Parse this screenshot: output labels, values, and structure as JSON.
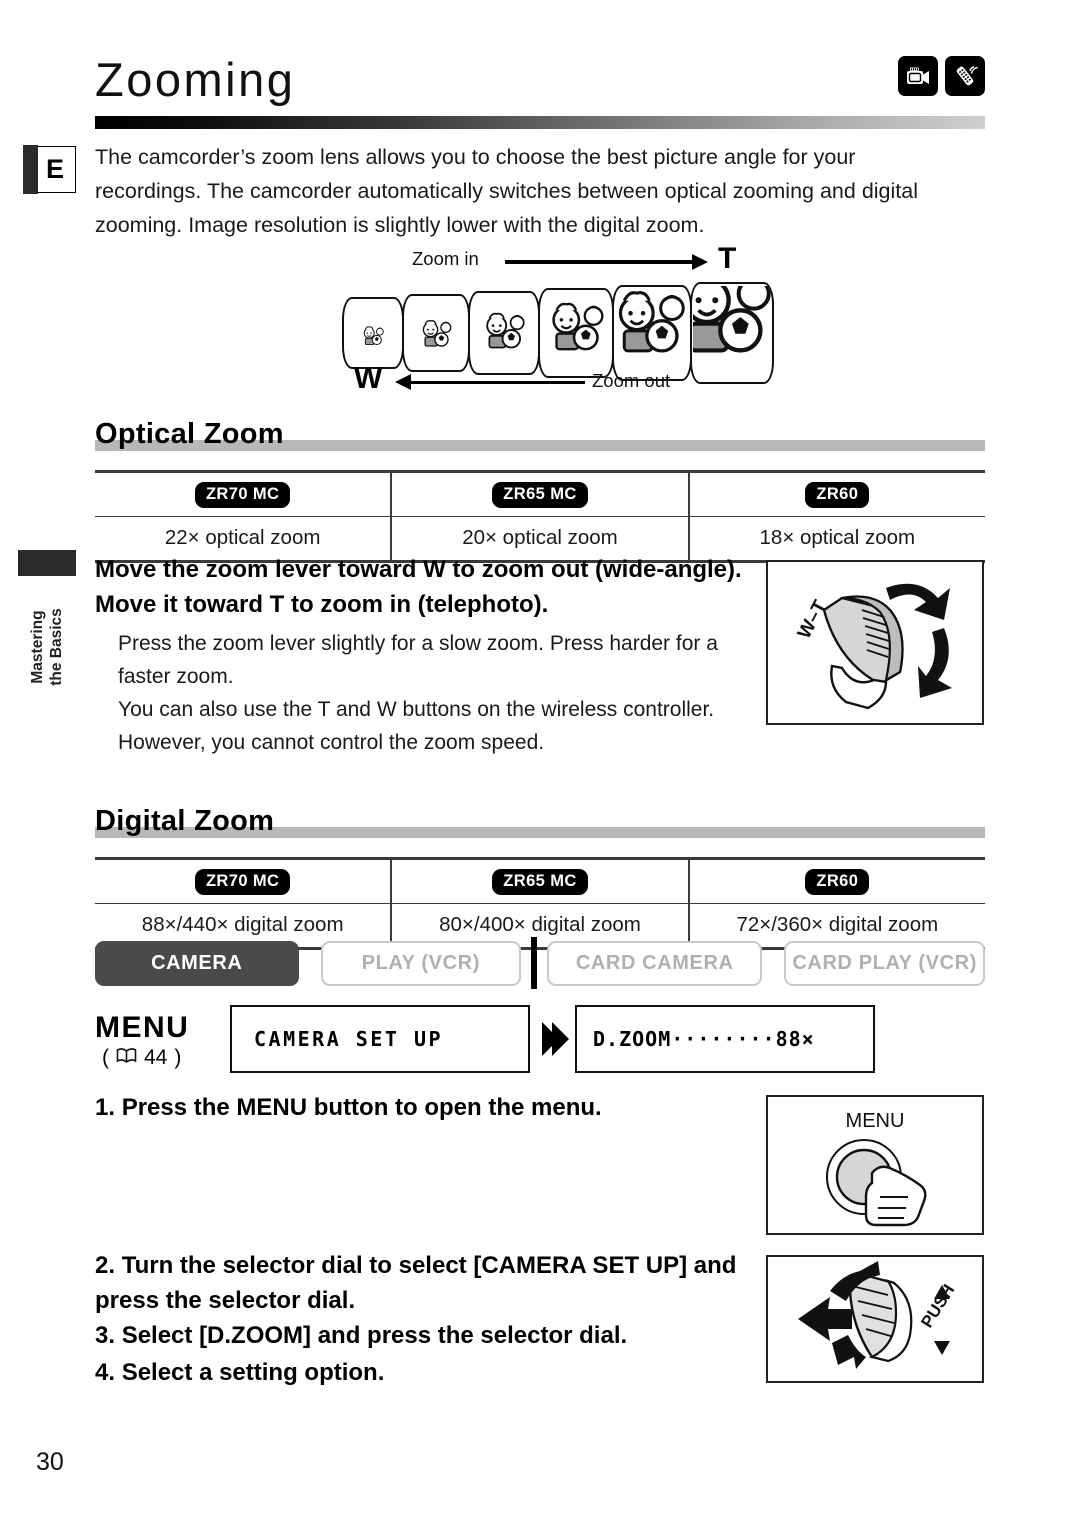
{
  "page": {
    "title": "Zooming",
    "number": "30",
    "language_badge": "E",
    "side_tab": {
      "line1": "Mastering",
      "line2": "the Basics"
    },
    "header_icons": [
      "camcorder-icon",
      "wireless-remote-icon"
    ]
  },
  "intro": "The camcorder’s zoom lens allows you to choose the best picture angle for your recordings. The camcorder automatically switches between optical zooming and digital zooming. Image resolution is slightly lower with the digital zoom.",
  "zoom_illustration": {
    "zoom_in_label": "Zoom in",
    "zoom_out_label": "Zoom out",
    "tele_letter": "T",
    "wide_letter": "W",
    "frame_count": 6
  },
  "optical": {
    "heading": "Optical Zoom",
    "models": [
      "ZR70 MC",
      "ZR65 MC",
      "ZR60"
    ],
    "values": [
      "22× optical zoom",
      "20× optical zoom",
      "18× optical zoom"
    ]
  },
  "lever_instruction": {
    "bold": "Move the zoom lever toward W to zoom out (wide-angle). Move it toward T to zoom in (telephoto).",
    "body1": "Press the zoom lever slightly for a slow zoom. Press harder for a faster zoom.",
    "body2": "You can also use the T and W buttons on the wireless controller. However, you cannot control the zoom speed.",
    "illustration_label": "W–T"
  },
  "digital": {
    "heading": "Digital Zoom",
    "models": [
      "ZR70 MC",
      "ZR65 MC",
      "ZR60"
    ],
    "values": [
      "88×/440× digital zoom",
      "80×/400× digital zoom",
      "72×/360× digital zoom"
    ]
  },
  "modes": [
    {
      "label": "CAMERA",
      "active": true
    },
    {
      "label": "PLAY (VCR)",
      "active": false
    },
    {
      "label": "CARD CAMERA",
      "active": false
    },
    {
      "label": "CARD PLAY (VCR)",
      "active": false
    }
  ],
  "menu_flow": {
    "menu_label": "MENU",
    "page_ref": "44",
    "book_icon": "book-icon",
    "screen1": "CAMERA  SET  UP",
    "screen2": "D.ZOOM········88×"
  },
  "steps": [
    {
      "num": "1.",
      "text": "Press the MENU button to open the menu."
    },
    {
      "num": "2.",
      "text": "Turn the selector dial to select [CAMERA SET UP] and press the selector dial."
    },
    {
      "num": "3.",
      "text": "Select [D.ZOOM] and press the selector dial."
    },
    {
      "num": "4.",
      "text": "Select a setting option."
    }
  ],
  "step_illustrations": {
    "menu_button_label": "MENU",
    "selector_dial_label": "PUSH"
  }
}
